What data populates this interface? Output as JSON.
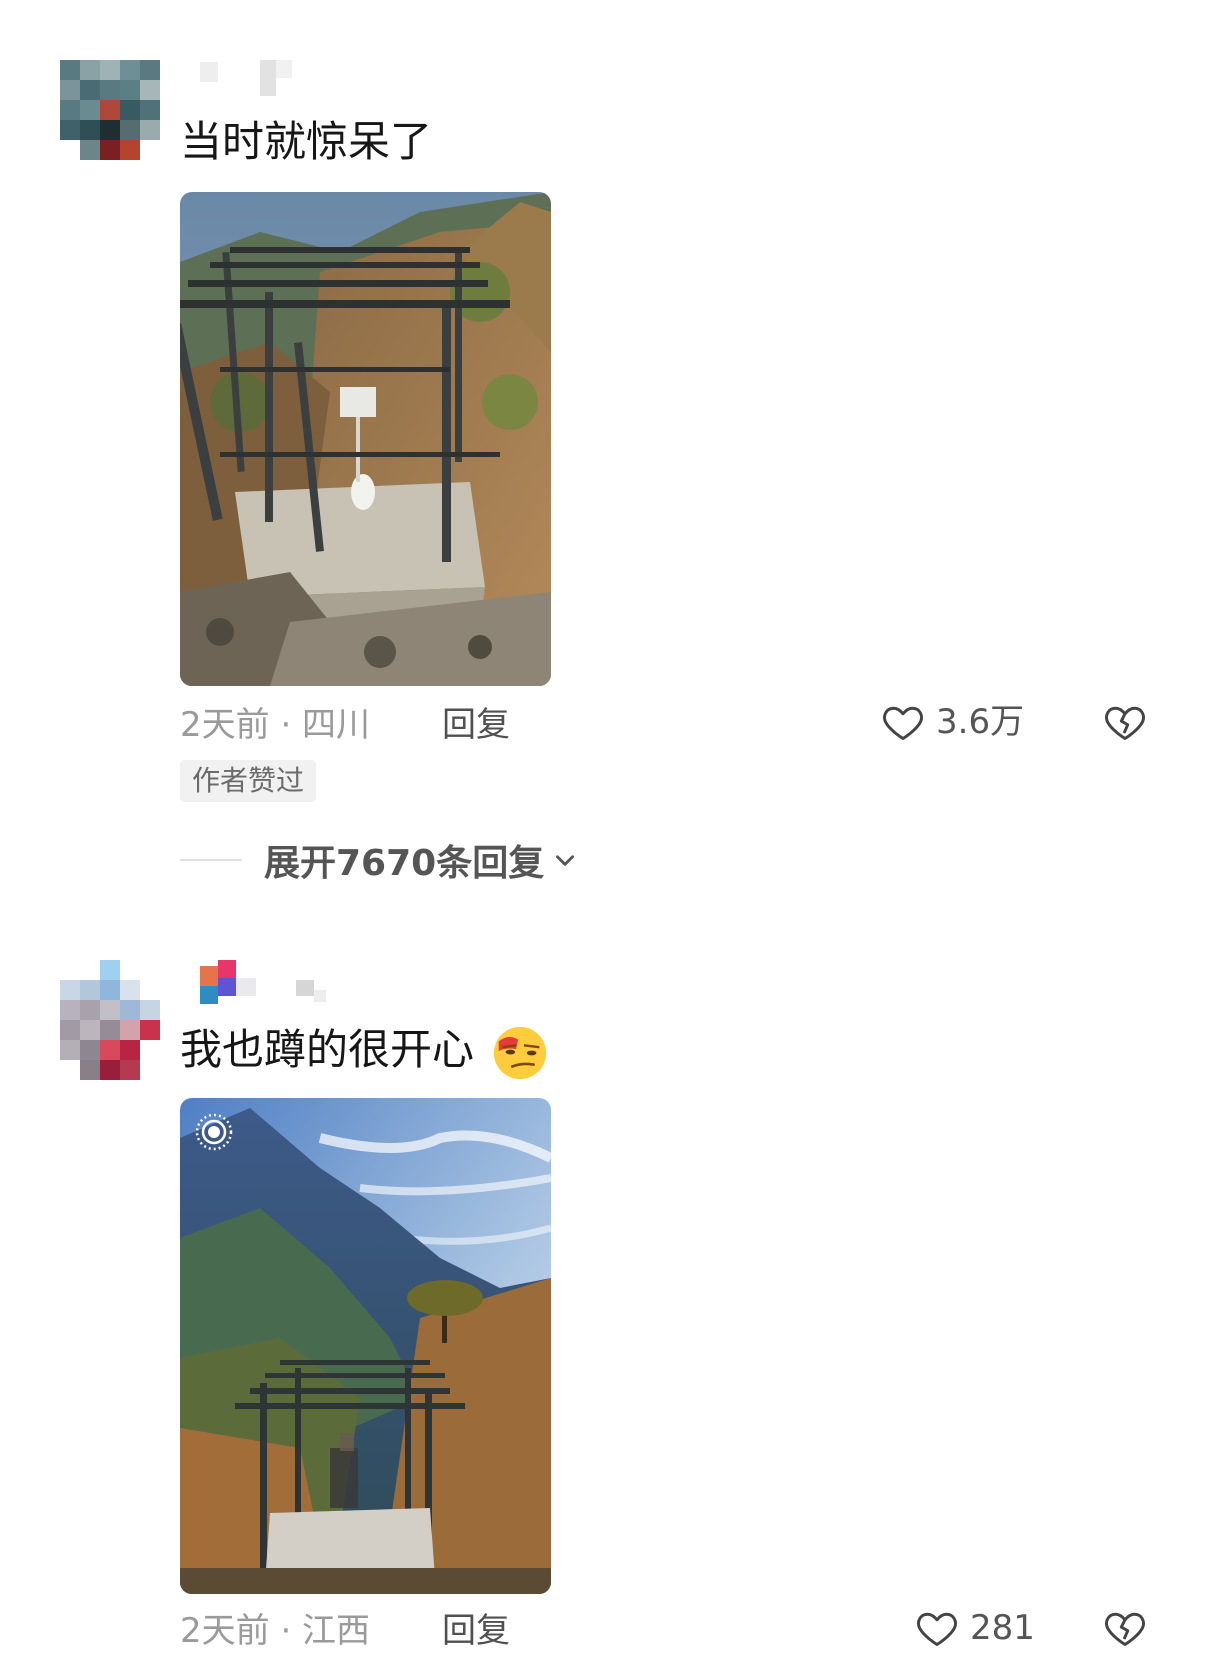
{
  "comments": [
    {
      "text": "当时就惊呆了",
      "time_location": "2天前 · 四川",
      "reply_label": "回复",
      "like_count": "3.6万",
      "badge": "作者赞过",
      "expand_label": "展开7670条回复"
    },
    {
      "text": "我也蹲的很开心",
      "time_location": "2天前 · 江西",
      "reply_label": "回复",
      "like_count": "281",
      "emoji": "smirk-emoji"
    }
  ],
  "icons": {
    "like": "heart-outline-icon",
    "dislike": "broken-heart-icon",
    "expand": "chevron-down-icon",
    "live_photo": "live-photo-icon"
  },
  "colors": {
    "primary_text": "#161616",
    "secondary_text": "#9a9a9a",
    "badge_bg": "#f1f1f1"
  }
}
